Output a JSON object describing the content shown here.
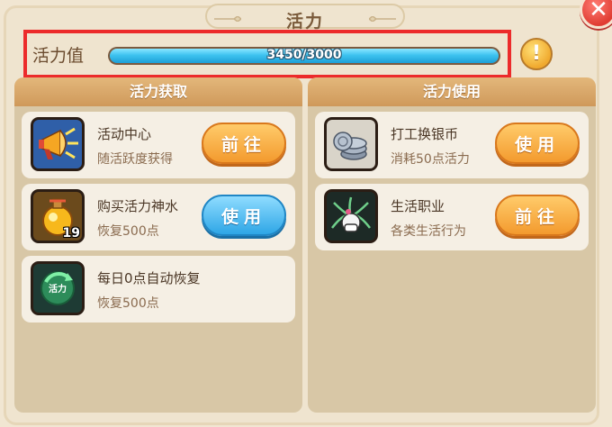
{
  "window": {
    "title": "活力",
    "close_icon": "close-icon"
  },
  "energy": {
    "label": "活力值",
    "value_text": "3450/3000",
    "current": 3450,
    "max": 3000,
    "fill_fraction": 1.0,
    "info_icon": "exclamation-icon"
  },
  "left_panel": {
    "header": "活力获取",
    "items": [
      {
        "title": "活动中心",
        "subtitle": "随活跃度获得",
        "icon": "megaphone-icon",
        "button": "前往",
        "button_color": "orange"
      },
      {
        "title": "购买活力神水",
        "subtitle": "恢复500点",
        "icon": "potion-icon",
        "badge": "19",
        "button": "使用",
        "button_color": "blue"
      },
      {
        "title": "每日0点自动恢复",
        "subtitle": "恢复500点",
        "icon": "energy-refresh-icon",
        "icon_text": "活力"
      }
    ]
  },
  "right_panel": {
    "header": "活力使用",
    "items": [
      {
        "title": "打工换银币",
        "subtitle": "消耗50点活力",
        "icon": "silver-coins-icon",
        "button": "使用",
        "button_color": "orange"
      },
      {
        "title": "生活职业",
        "subtitle": "各类生活行为",
        "icon": "life-profession-icon",
        "button": "前往",
        "button_color": "orange"
      }
    ]
  },
  "colors": {
    "highlight": "#ec2b2b",
    "bar_fill": "#3ec3f0",
    "orange_button": "#f39a2e",
    "blue_button": "#2ea6e6"
  }
}
